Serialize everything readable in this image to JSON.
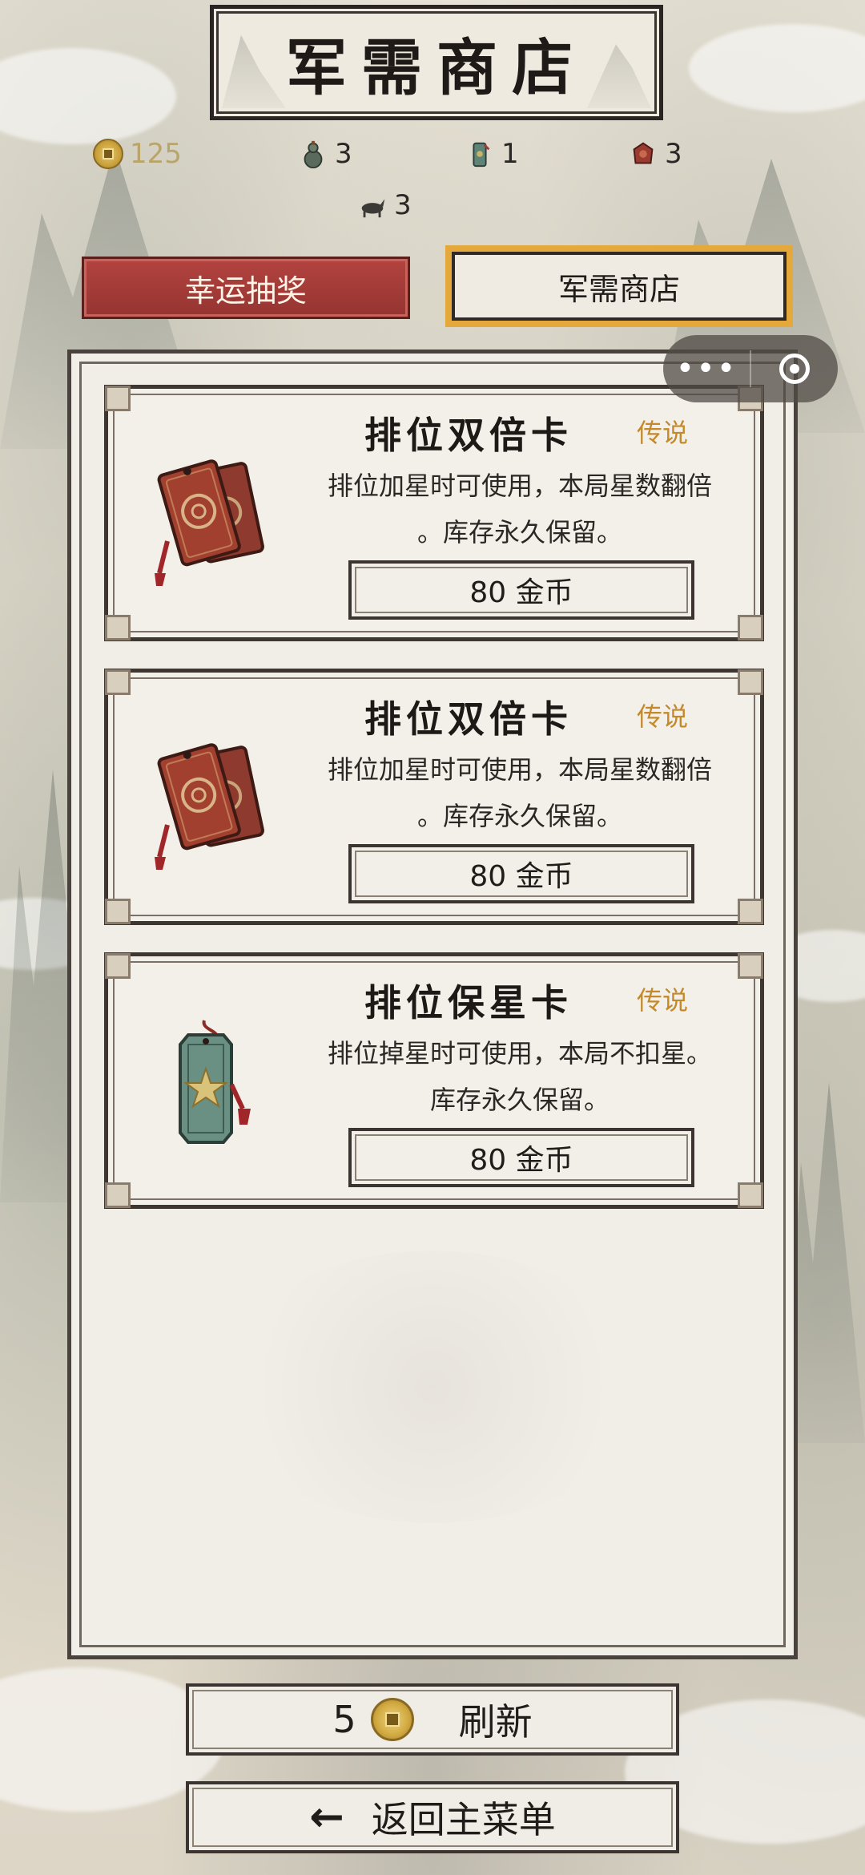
{
  "title": "军需商店",
  "resources": {
    "coins": "125",
    "item1": "3",
    "item2": "1",
    "item3": "3",
    "item4": "3"
  },
  "tabs": {
    "lottery": "幸运抽奖",
    "shop": "军需商店"
  },
  "items": [
    {
      "name": "排位双倍卡",
      "rarity": "传说",
      "desc_line1": "排位加星时可使用，本局星数翻倍",
      "desc_line2": "。库存永久保留。",
      "price": "80 金币",
      "icon": "double-card-icon"
    },
    {
      "name": "排位双倍卡",
      "rarity": "传说",
      "desc_line1": "排位加星时可使用，本局星数翻倍",
      "desc_line2": "。库存永久保留。",
      "price": "80 金币",
      "icon": "double-card-icon"
    },
    {
      "name": "排位保星卡",
      "rarity": "传说",
      "desc_line1": "排位掉星时可使用，本局不扣星。",
      "desc_line2": "库存永久保留。",
      "price": "80 金币",
      "icon": "star-protect-card-icon"
    }
  ],
  "bottom": {
    "refresh_cost": "5",
    "refresh_label": "刷新",
    "back_label": "返回主菜单"
  },
  "colors": {
    "accent_red": "#a63b37",
    "accent_gold": "#e4a93a",
    "rarity_gold": "#c4892b"
  }
}
